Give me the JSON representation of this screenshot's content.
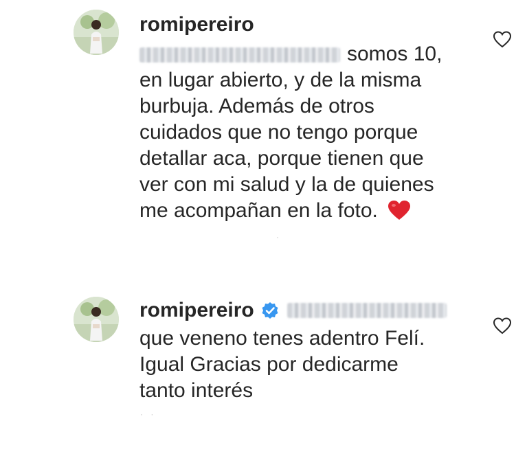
{
  "comments": [
    {
      "username": "romipereiro",
      "verified": false,
      "mention_blurred": true,
      "text_lines": [
        "somos 10,",
        "en lugar abierto, y de la misma",
        "burbuja. Además de otros",
        "cuidados que no tengo porque",
        "detallar aca, porque tienen que",
        "ver con mi salud y la de quienes",
        "me acompañan en la foto."
      ],
      "emoji": "red-heart",
      "like_icon": "heart-outline-icon"
    },
    {
      "username": "romipereiro",
      "verified": true,
      "mention_blurred": true,
      "text_lines": [
        "que veneno tenes adentro Felí.",
        "Igual Gracias por dedicarme",
        "tanto interés"
      ],
      "like_icon": "heart-outline-icon"
    }
  ],
  "colors": {
    "text": "#262626",
    "verified_badge": "#3897f0",
    "heart_emoji": "#e0242f",
    "like_outline": "#8e8e8e"
  }
}
